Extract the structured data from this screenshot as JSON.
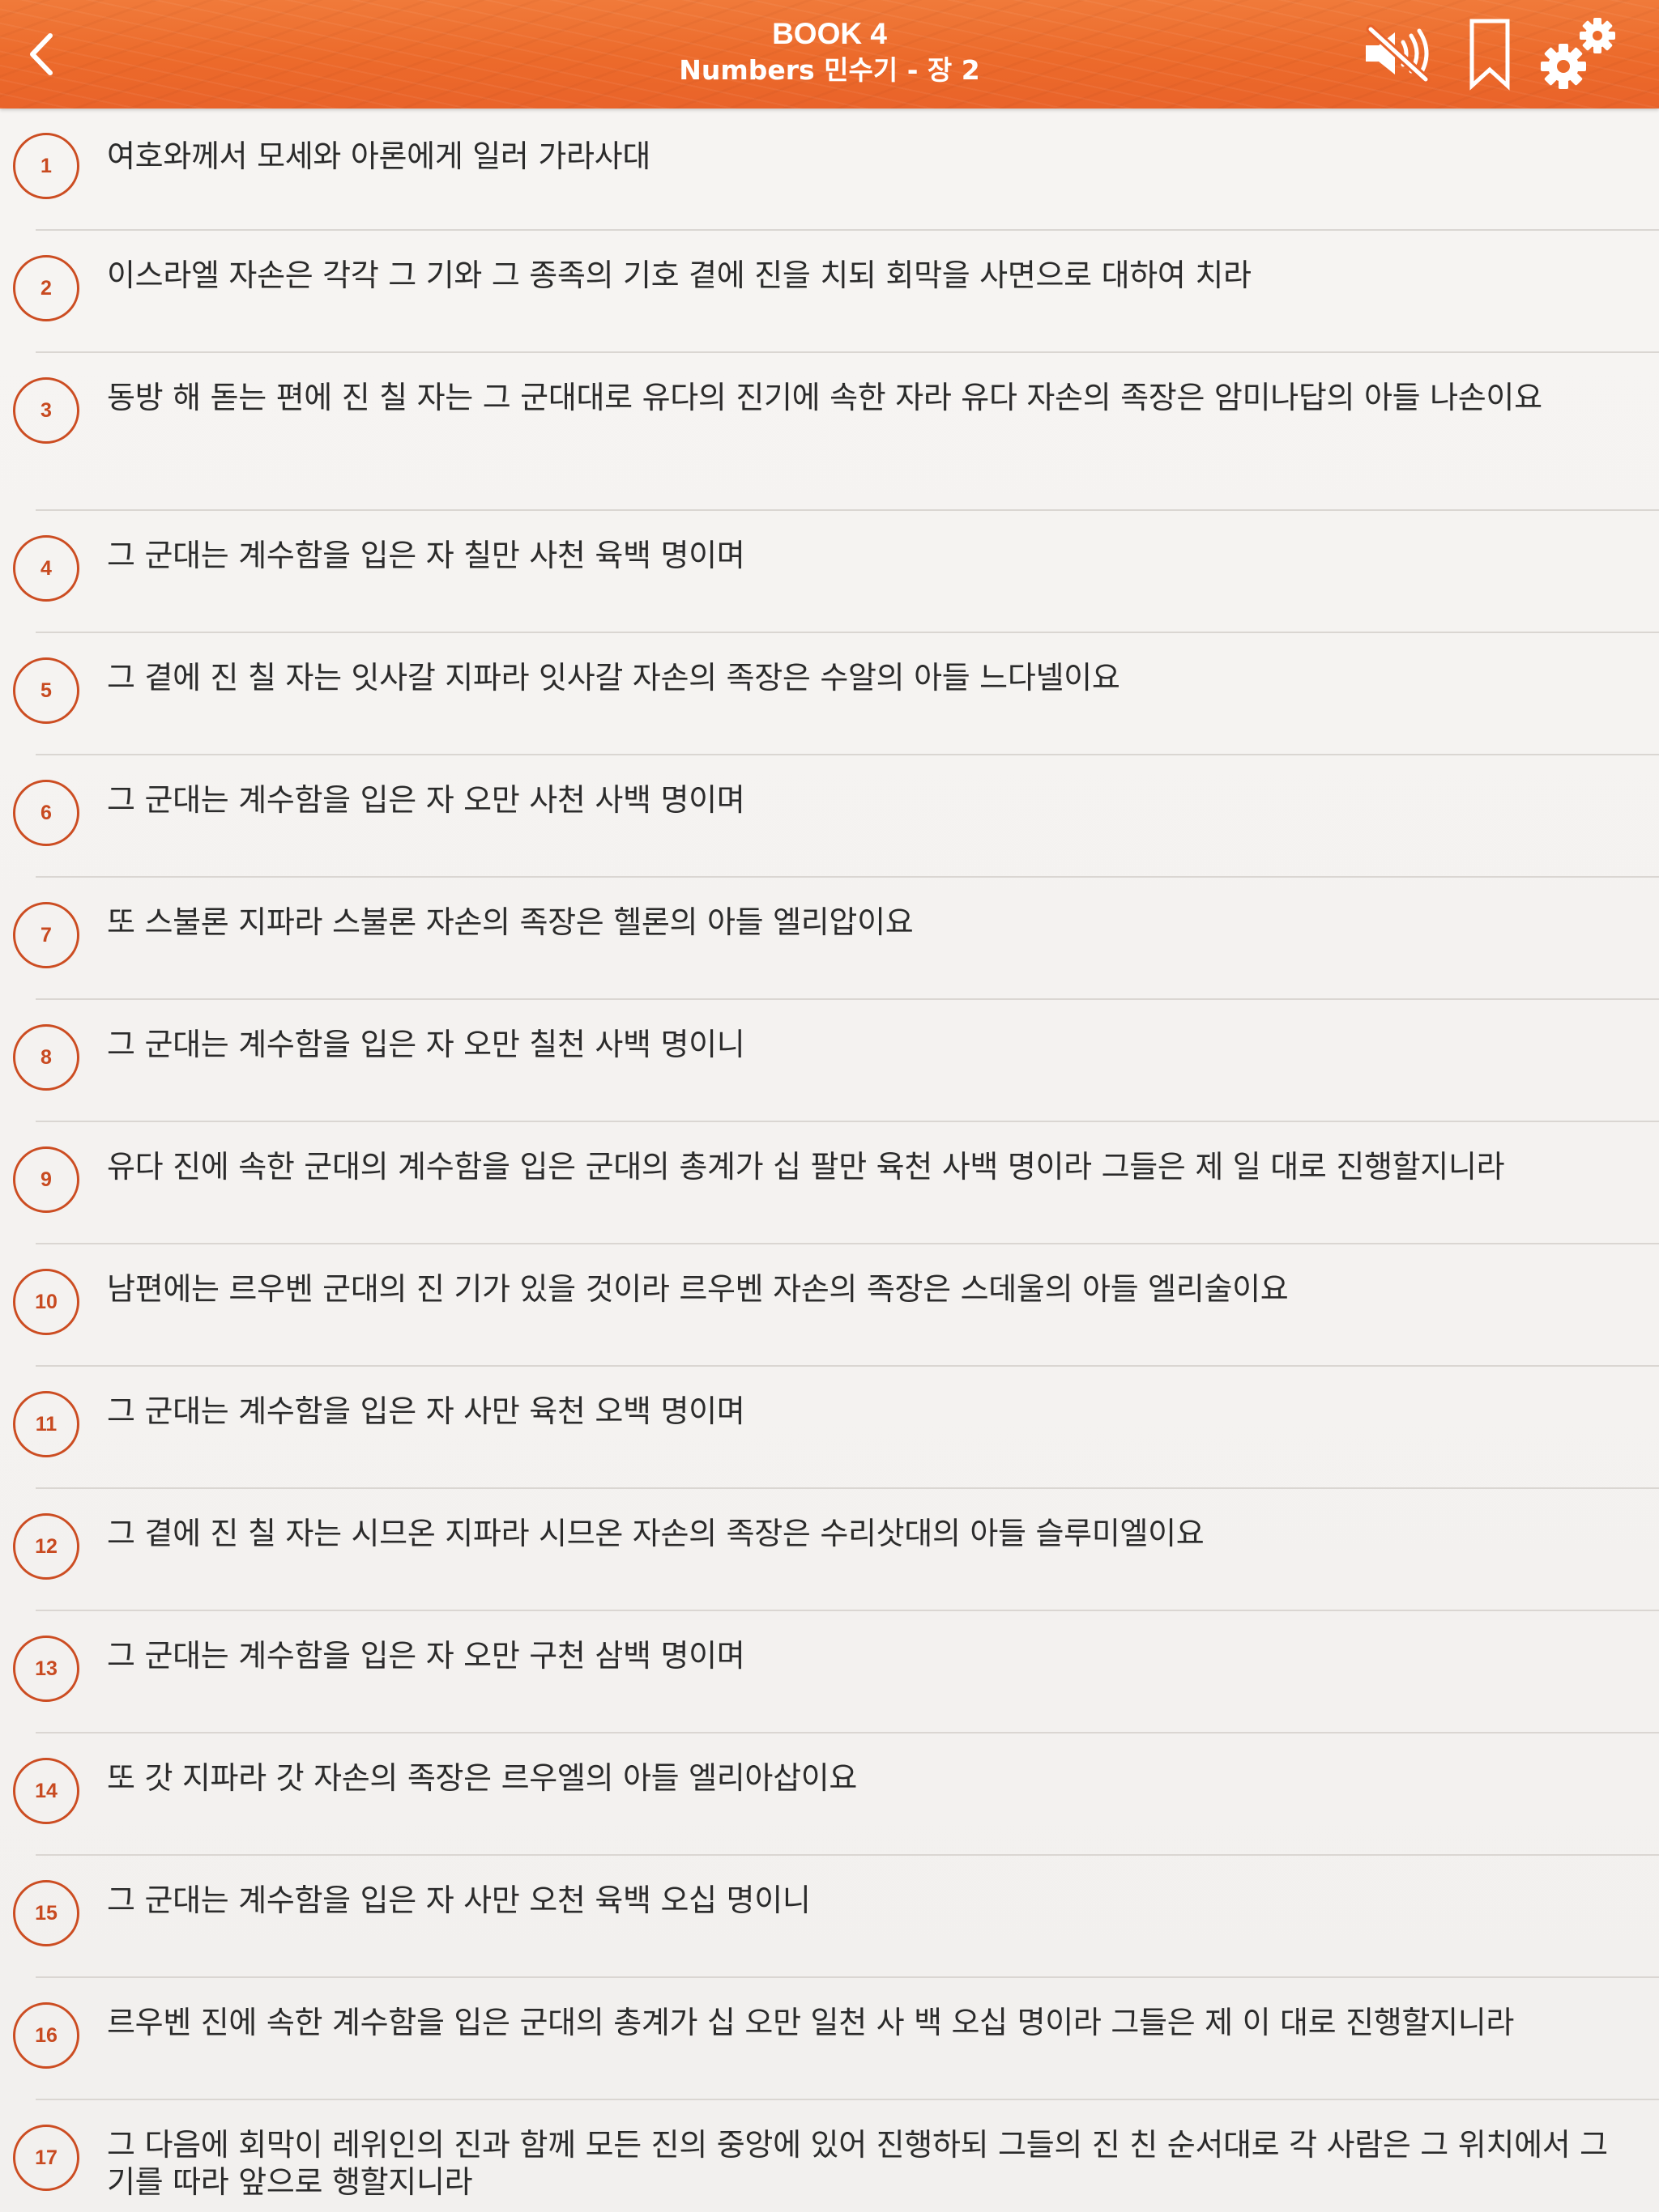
{
  "header": {
    "book_label": "BOOK 4",
    "chapter_title": "Numbers 민수기 - 장 2",
    "back_icon": "chevron-left-icon",
    "mute_icon": "speaker-muted-icon",
    "bookmark_icon": "bookmark-icon",
    "settings_icon": "gears-icon",
    "accent_color": "#ec6a2b"
  },
  "verses": [
    {
      "number": "1",
      "text": "여호와께서 모세와 아론에게 일러 가라사대"
    },
    {
      "number": "2",
      "text": "이스라엘 자손은 각각 그 기와 그 종족의 기호 곁에 진을 치되 회막을 사면으로 대하여 치라"
    },
    {
      "number": "3",
      "text": "동방 해 돋는 편에 진 칠 자는 그 군대대로 유다의 진기에 속한 자라 유다 자손의 족장은 암미나답의 아들 나손이요"
    },
    {
      "number": "4",
      "text": "그 군대는 계수함을 입은 자 칠만 사천 육백 명이며"
    },
    {
      "number": "5",
      "text": "그 곁에 진 칠 자는 잇사갈 지파라 잇사갈 자손의 족장은 수알의 아들 느다넬이요"
    },
    {
      "number": "6",
      "text": "그 군대는 계수함을 입은 자 오만 사천 사백 명이며"
    },
    {
      "number": "7",
      "text": "또 스불론 지파라 스불론 자손의 족장은 헬론의 아들 엘리압이요"
    },
    {
      "number": "8",
      "text": "그 군대는 계수함을 입은 자 오만 칠천 사백 명이니"
    },
    {
      "number": "9",
      "text": "유다 진에 속한 군대의 계수함을 입은 군대의 총계가 십 팔만 육천 사백 명이라 그들은 제 일 대로 진행할지니라"
    },
    {
      "number": "10",
      "text": "남편에는 르우벤 군대의 진 기가 있을 것이라 르우벤 자손의 족장은 스데울의 아들 엘리술이요"
    },
    {
      "number": "11",
      "text": "그 군대는 계수함을 입은 자 사만 육천 오백 명이며"
    },
    {
      "number": "12",
      "text": "그 곁에 진 칠 자는 시므온 지파라 시므온 자손의 족장은 수리삿대의 아들 슬루미엘이요"
    },
    {
      "number": "13",
      "text": "그 군대는 계수함을 입은 자 오만 구천 삼백 명이며"
    },
    {
      "number": "14",
      "text": "또 갓 지파라 갓 자손의 족장은 르우엘의 아들 엘리아삽이요"
    },
    {
      "number": "15",
      "text": "그 군대는 계수함을 입은 자 사만 오천 육백 오십 명이니"
    },
    {
      "number": "16",
      "text": "르우벤 진에 속한 계수함을 입은 군대의 총계가 십 오만 일천 사 백 오십 명이라 그들은 제 이 대로 진행할지니라"
    },
    {
      "number": "17",
      "text": "그 다음에 회막이 레위인의 진과 함께 모든 진의 중앙에 있어 진행하되 그들의 진 친 순서대로 각 사람은 그 위치에서 그 기를 따라 앞으로 행할지니라"
    }
  ]
}
